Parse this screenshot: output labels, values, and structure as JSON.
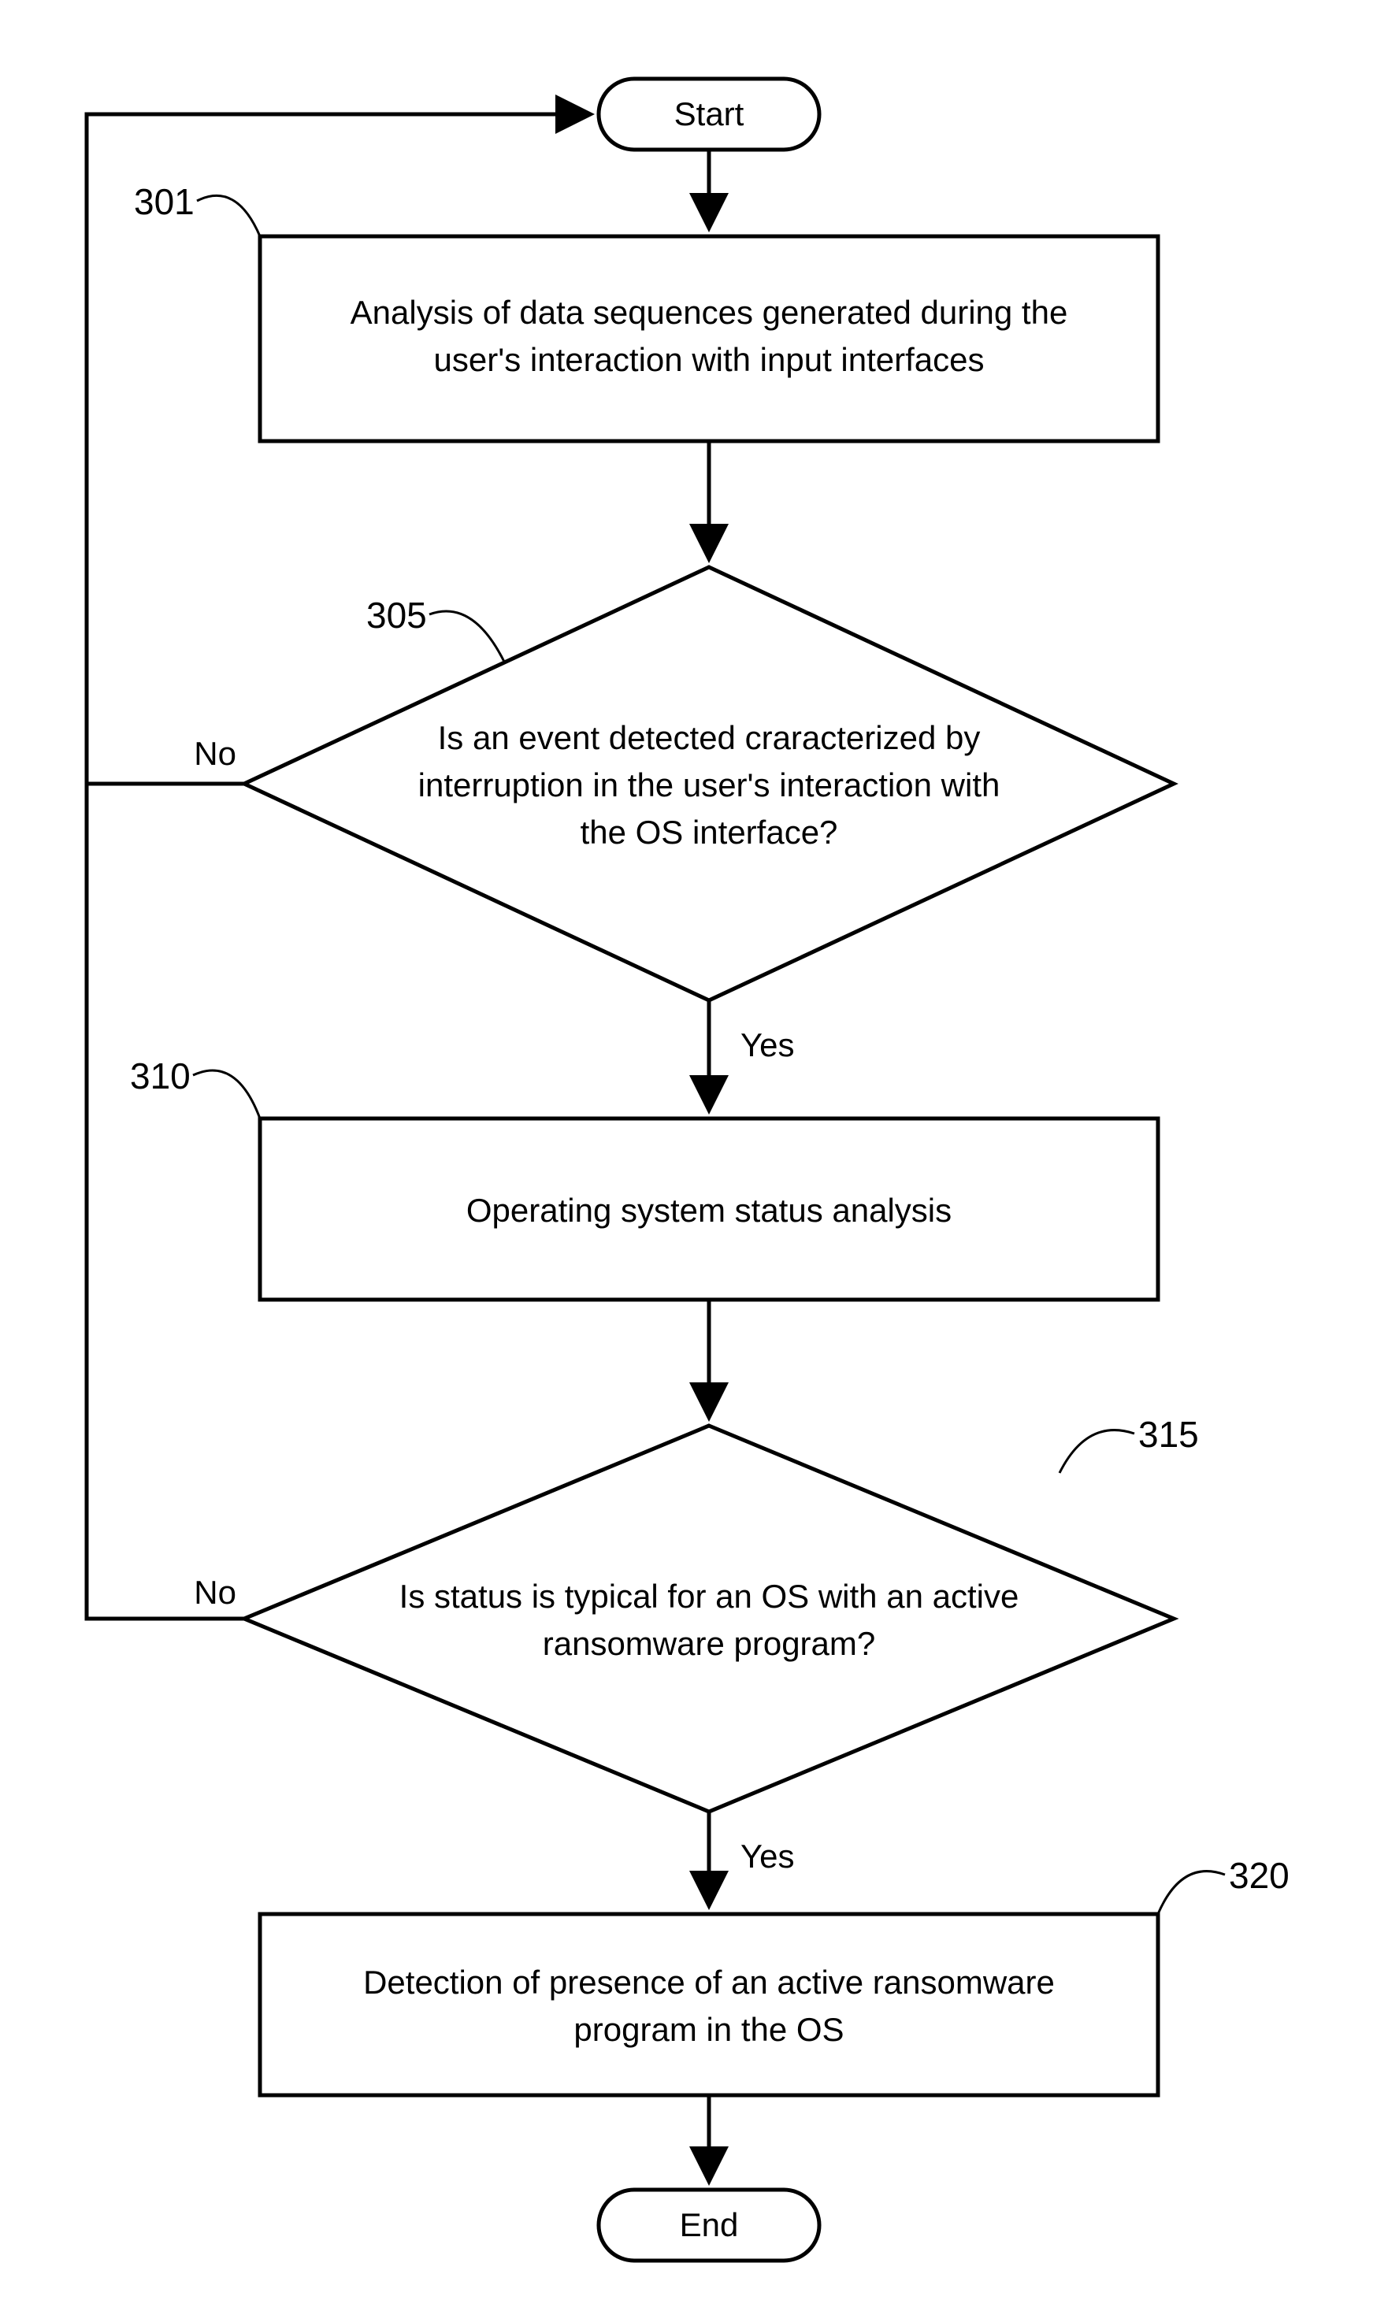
{
  "terminals": {
    "start": "Start",
    "end": "End"
  },
  "process": {
    "step1": {
      "line1": "Analysis of data sequences generated during the",
      "line2": "user's interaction with input interfaces"
    },
    "step3": "Operating system status analysis",
    "step5": {
      "line1": "Detection of presence of an active ransomware",
      "line2": "program in the OS"
    }
  },
  "decision": {
    "step2": {
      "line1": "Is an event detected craracterized by",
      "line2": "interruption in the user's interaction with",
      "line3": "the OS interface?"
    },
    "step4": {
      "line1": "Is status is typical for an OS with an active",
      "line2": "ransomware program?"
    }
  },
  "labels": {
    "yes": "Yes",
    "no": "No"
  },
  "refs": {
    "r301": "301",
    "r305": "305",
    "r310": "310",
    "r315": "315",
    "r320": "320"
  }
}
